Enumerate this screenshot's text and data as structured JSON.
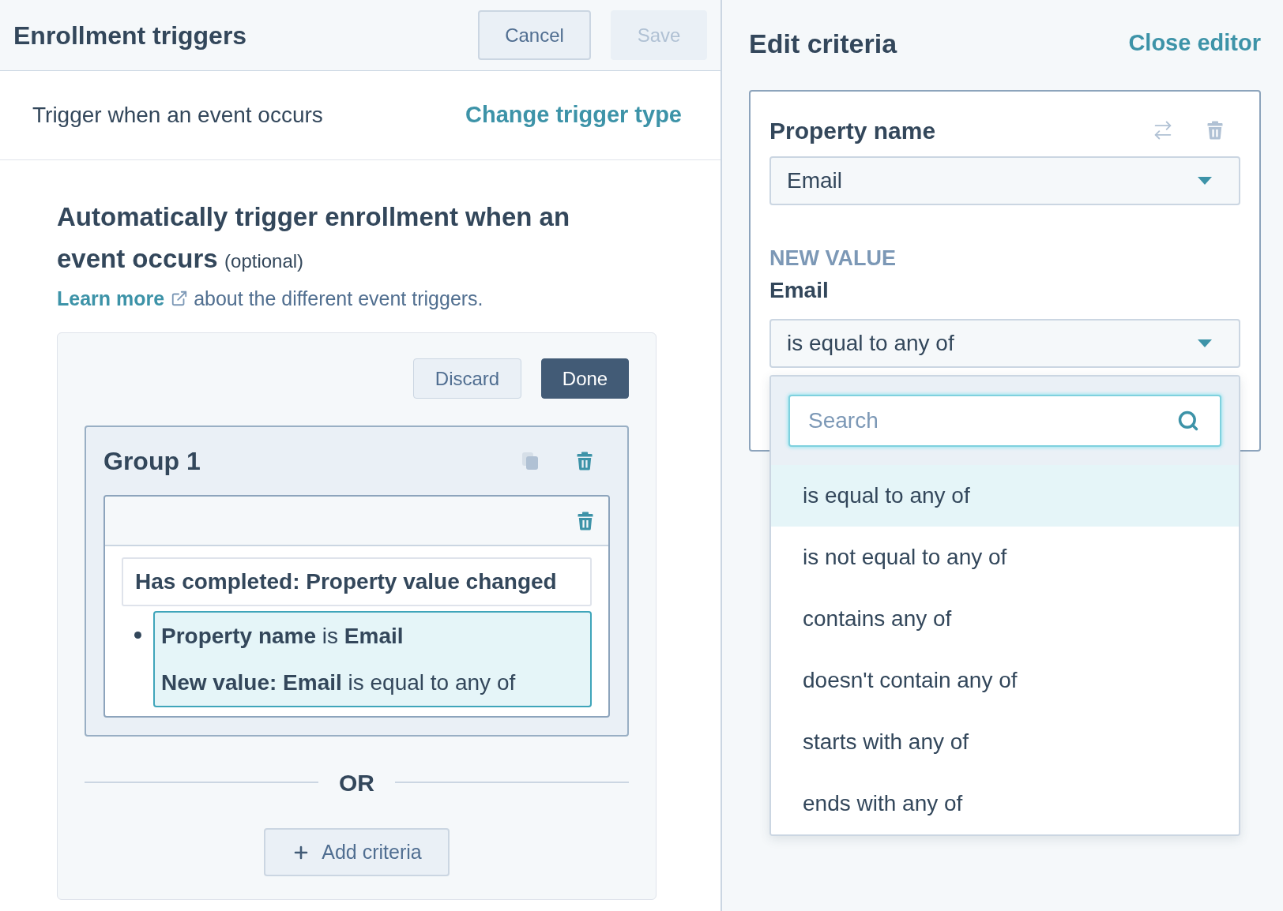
{
  "enrollment": {
    "title": "Enrollment triggers",
    "buttons": [
      {
        "label": "Cancel",
        "disabled": false
      },
      {
        "label": "Save",
        "disabled": true
      }
    ]
  },
  "trigger": {
    "text": "Trigger when an event occurs",
    "link": "Change trigger type"
  },
  "intro": {
    "heading": "Automatically trigger enrollment when an event occurs",
    "note": "(optional)",
    "help_link": "Learn more",
    "help_text": "about the different event triggers."
  },
  "editor_card": {
    "buttons": [
      {
        "label": "Discard",
        "kind": "secondary"
      },
      {
        "label": "Done",
        "kind": "primary"
      }
    ],
    "groups": [
      {
        "title": "Group 1",
        "actions": [
          {
            "kind": "copy",
            "disabled": true
          },
          {
            "kind": "delete",
            "disabled": false
          }
        ],
        "filters": [
          {
            "actions": [
              {
                "kind": "delete",
                "disabled": false
              }
            ],
            "event": "Has completed: Property value changed",
            "criteria": [
              {
                "lines": [
                  "**Property name** is **Email**",
                  "**New value: Email** is equal to any of"
                ],
                "selected": true
              }
            ]
          }
        ]
      }
    ],
    "separator": "OR",
    "add_button": "Add criteria"
  },
  "edit_criteria": {
    "title": "Edit criteria",
    "close": "Close editor",
    "property": {
      "label": "Property name",
      "actions": [
        {
          "kind": "swap",
          "disabled": true
        },
        {
          "kind": "delete",
          "disabled": true
        }
      ],
      "value": "Email"
    },
    "new_value": {
      "section": "NEW VALUE",
      "label": "Email",
      "operator": {
        "value": "is equal to any of",
        "expanded": true,
        "search": {
          "placeholder": "Search"
        },
        "options": [
          {
            "label": "is equal to any of",
            "selected": true
          },
          {
            "label": "is not equal to any of",
            "selected": false
          },
          {
            "label": "contains any of",
            "selected": false
          },
          {
            "label": "doesn't contain any of",
            "selected": false
          },
          {
            "label": "starts with any of",
            "selected": false
          },
          {
            "label": "ends with any of",
            "selected": false
          }
        ]
      }
    }
  }
}
